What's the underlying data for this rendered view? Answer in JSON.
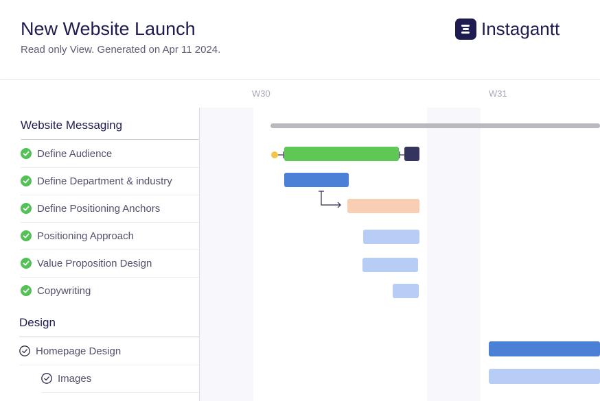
{
  "header": {
    "title": "New Website Launch",
    "subtitle": "Read only View. Generated on Apr 11 2024."
  },
  "brand": {
    "name": "Instagantt",
    "logo_icon": "instagantt-logo-icon",
    "color": "#1d1b4f"
  },
  "timeline": {
    "weeks": [
      "W30",
      "W31"
    ]
  },
  "groups": [
    {
      "title": "Website Messaging",
      "tasks": [
        {
          "label": "Define Audience",
          "status": "done"
        },
        {
          "label": "Define Department & industry",
          "status": "done"
        },
        {
          "label": "Define Positioning Anchors",
          "status": "done"
        },
        {
          "label": "Positioning Approach",
          "status": "done"
        },
        {
          "label": "Value Proposition Design",
          "status": "done"
        },
        {
          "label": "Copywriting",
          "status": "done"
        }
      ]
    },
    {
      "title": "Design",
      "tasks": [
        {
          "label": "Homepage Design",
          "status": "open"
        },
        {
          "label": "Images",
          "status": "open",
          "subtask": true
        }
      ]
    }
  ],
  "colors": {
    "done_check": "#53c155",
    "group_bar": "#b9b9bf",
    "bar_green": "#5fc756",
    "bar_navy": "#35345e",
    "bar_blue": "#4c7fd6",
    "bar_peach": "#f8cfb3",
    "bar_light_blue": "#b7cdf5",
    "milestone_dot": "#f5c547"
  }
}
